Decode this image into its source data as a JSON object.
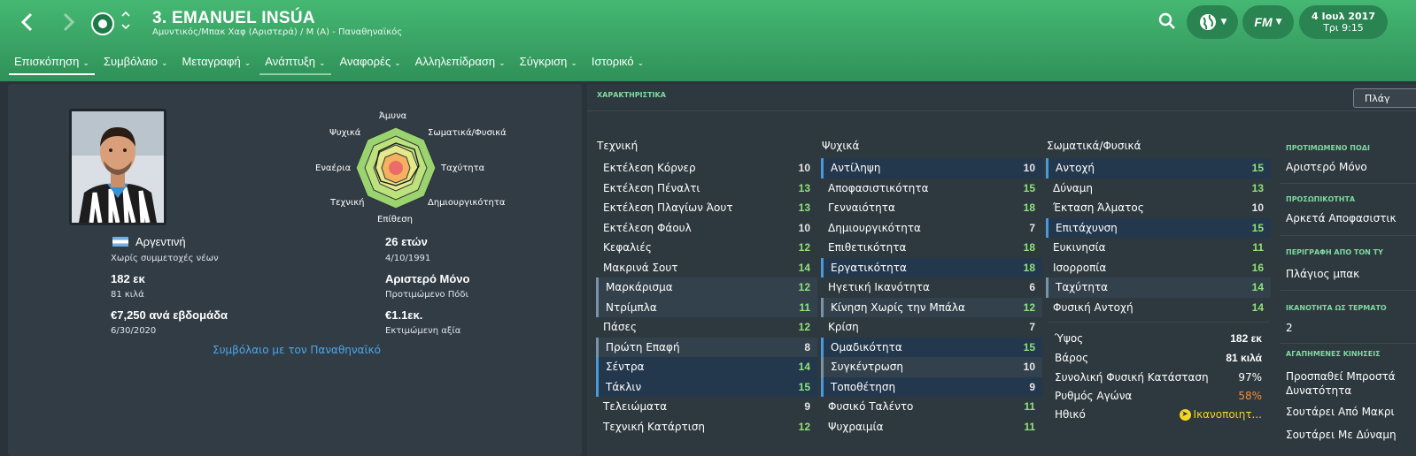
{
  "header": {
    "back_icon": "chevron-left-icon",
    "forward_icon": "chevron-right-icon",
    "player_title": "3. EMANUEL INSÚA",
    "player_subtitle": "Αμυντικός/Μπακ Χαφ (Αριστερά) / Μ (Α) - Παναθηναϊκός",
    "date_main": "4 Ιουλ 2017",
    "date_sub": "Τρι 9:15",
    "fm_label": "FM"
  },
  "tabs": [
    {
      "label": "Επισκόπηση"
    },
    {
      "label": "Συμβόλαιο"
    },
    {
      "label": "Μεταγραφή"
    },
    {
      "label": "Ανάπτυξη"
    },
    {
      "label": "Αναφορές"
    },
    {
      "label": "Αλληλεπίδραση"
    },
    {
      "label": "Σύγκριση"
    },
    {
      "label": "Ιστορικό"
    }
  ],
  "radar": {
    "labels": {
      "top": "Άμυνα",
      "top_right": "Σωματικά/Φυσικά",
      "right": "Ταχύτητα",
      "bottom_right": "Δημιουργικότητα",
      "bottom": "Επίθεση",
      "bottom_left": "Τεχνική",
      "left": "Εναέρια",
      "top_left": "Ψυχικά"
    }
  },
  "profile": {
    "nationality": "Αργεντινή",
    "youth_caps": "Χωρίς συμμετοχές νέων",
    "age": "26 ετών",
    "dob": "4/10/1991",
    "height": "182 εκ",
    "weight": "81 κιλά",
    "foot": "Αριστερό Μόνο",
    "foot_label": "Προτιμώμενο Πόδι",
    "wage": "€7,250 ανά εβδομάδα",
    "contract_end": "6/30/2020",
    "value": "€1.1εκ.",
    "value_label": "Εκτιμώμενη αξία",
    "contract_link": "Συμβόλαιο με τον Παναθηναϊκό"
  },
  "attributes": {
    "section_title": "ΧΑΡΑΚΤΗΡΙΣΤΙΚΑ",
    "position_button": "Πλάγ",
    "technical": {
      "title": "Τεχνική",
      "items": [
        {
          "name": "Εκτέλεση Κόρνερ",
          "value": "10"
        },
        {
          "name": "Εκτέλεση Πέναλτι",
          "value": "13"
        },
        {
          "name": "Εκτέλεση Πλαγίων Άουτ",
          "value": "13"
        },
        {
          "name": "Εκτέλεση Φάουλ",
          "value": "10"
        },
        {
          "name": "Κεφαλιές",
          "value": "12"
        },
        {
          "name": "Μακρινά Σουτ",
          "value": "14"
        },
        {
          "name": "Μαρκάρισμα",
          "value": "12"
        },
        {
          "name": "Ντρίμπλα",
          "value": "11"
        },
        {
          "name": "Πάσες",
          "value": "12"
        },
        {
          "name": "Πρώτη Επαφή",
          "value": "8"
        },
        {
          "name": "Σέντρα",
          "value": "14"
        },
        {
          "name": "Τάκλιν",
          "value": "15"
        },
        {
          "name": "Τελειώματα",
          "value": "9"
        },
        {
          "name": "Τεχνική Κατάρτιση",
          "value": "12"
        }
      ]
    },
    "mental": {
      "title": "Ψυχικά",
      "items": [
        {
          "name": "Αντίληψη",
          "value": "10"
        },
        {
          "name": "Αποφασιστικότητα",
          "value": "15"
        },
        {
          "name": "Γενναιότητα",
          "value": "18"
        },
        {
          "name": "Δημιουργικότητα",
          "value": "7"
        },
        {
          "name": "Επιθετικότητα",
          "value": "18"
        },
        {
          "name": "Εργατικότητα",
          "value": "18"
        },
        {
          "name": "Ηγετική Ικανότητα",
          "value": "6"
        },
        {
          "name": "Κίνηση Χωρίς την Μπάλα",
          "value": "12"
        },
        {
          "name": "Κρίση",
          "value": "7"
        },
        {
          "name": "Ομαδικότητα",
          "value": "15"
        },
        {
          "name": "Συγκέντρωση",
          "value": "10"
        },
        {
          "name": "Τοποθέτηση",
          "value": "9"
        },
        {
          "name": "Φυσικό Ταλέντο",
          "value": "11"
        },
        {
          "name": "Ψυχραιμία",
          "value": "11"
        }
      ]
    },
    "physical": {
      "title": "Σωματικά/Φυσικά",
      "items": [
        {
          "name": "Αντοχή",
          "value": "15"
        },
        {
          "name": "Δύναμη",
          "value": "13"
        },
        {
          "name": "Έκταση Άλματος",
          "value": "10"
        },
        {
          "name": "Επιτάχυνση",
          "value": "15"
        },
        {
          "name": "Ευκινησία",
          "value": "11"
        },
        {
          "name": "Ισορροπία",
          "value": "16"
        },
        {
          "name": "Ταχύτητα",
          "value": "14"
        },
        {
          "name": "Φυσική Αντοχή",
          "value": "14"
        }
      ]
    },
    "info": [
      {
        "name": "Ύψος",
        "value": "182 εκ"
      },
      {
        "name": "Βάρος",
        "value": "81 κιλά"
      },
      {
        "name": "Συνολική Φυσική Κατάσταση",
        "value": "97%"
      },
      {
        "name": "Ρυθμός Αγώνα",
        "value": "58%"
      },
      {
        "name": "Ηθικό",
        "value": "Ικανοποιητ..."
      }
    ]
  },
  "sidebar": {
    "foot_title": "ΠΡΟΤΙΜΩΜΕΝΟ ΠΟΔΙ",
    "foot_value": "Αριστερό Μόνο",
    "personality_title": "ΠΡΟΣΩΠΙΚΟΤΗΤΑ",
    "personality_value": "Αρκετά Αποφασιστικ",
    "description_title": "ΠΕΡΙΓΡΑΦΗ ΑΠΟ ΤΟΝ ΤΥ",
    "description_value": "Πλάγιος μπακ",
    "ability_title": "ΙΚΑΝΟΤΗΤΑ ΩΣ ΤΕΡΜΑΤΟ",
    "ability_value": "2",
    "moves_title": "ΑΓΑΠΗΜΕΝΕΣ ΚΙΝΗΣΕΙΣ",
    "move1": "Προσπαθεί Μπροστά",
    "move1b": "Δυνατότητα",
    "move2": "Σουτάρει Από Μακρι",
    "move3": "Σουτάρει Με Δύναμη"
  }
}
